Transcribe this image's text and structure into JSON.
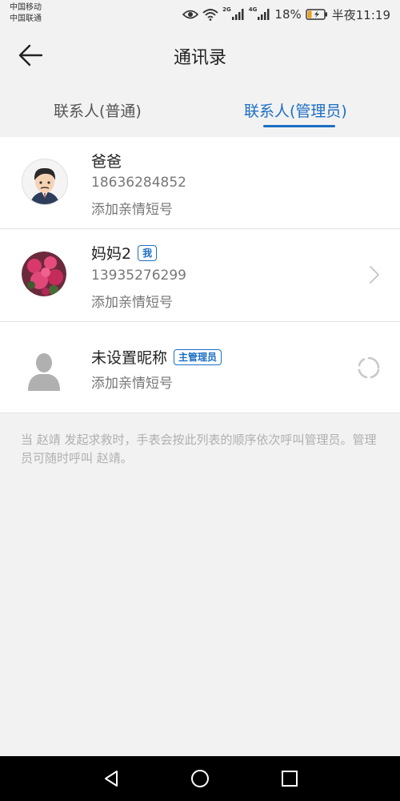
{
  "status_bar": {
    "carrier_1": "中国移动",
    "carrier_2": "中国联通",
    "net_1": "2G",
    "net_2": "4G",
    "battery": "18%",
    "time": "半夜11:19"
  },
  "header": {
    "title": "通讯录"
  },
  "tabs": [
    {
      "label": "联系人(普通)"
    },
    {
      "label": "联系人(管理员)",
      "active": true
    }
  ],
  "contacts": [
    {
      "name": "爸爸",
      "phone": "18636284852",
      "short_number": "添加亲情短号",
      "avatar": "cartoon-man-avatar"
    },
    {
      "name": "妈妈2",
      "tag": "我",
      "phone": "13935276299",
      "short_number": "添加亲情短号",
      "avatar": "flower-photo-avatar"
    },
    {
      "name": "未设置昵称",
      "tag": "主管理员",
      "short_number": "添加亲情短号",
      "avatar": "default-person-avatar"
    }
  ],
  "note": "当 赵靖 发起求救时，手表会按此列表的顺序依次呼叫管理员。管理员可随时呼叫 赵靖。",
  "colors": {
    "accent": "#1c6fc4",
    "background": "#f2f2f2"
  }
}
